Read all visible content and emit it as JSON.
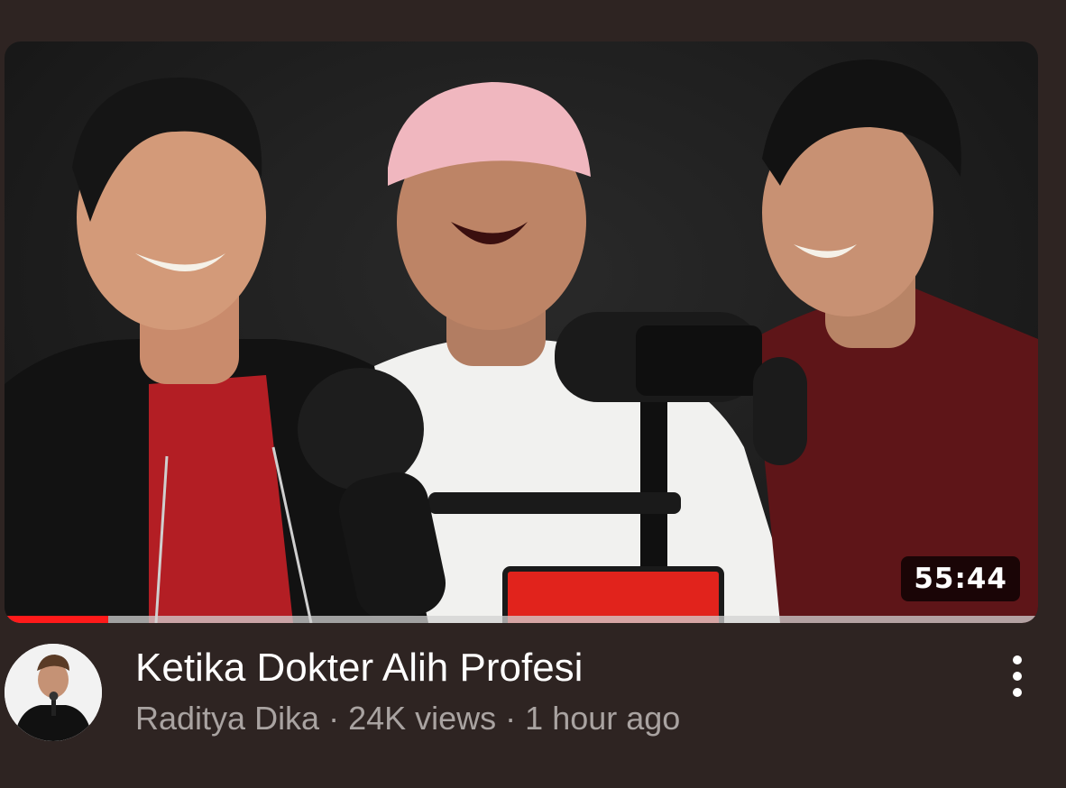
{
  "video": {
    "duration": "55:44",
    "progress_fraction": 0.1,
    "title": "Ketika Dokter Alih Profesi",
    "channel": "Raditya Dika",
    "views": "24K views",
    "age": "1 hour ago",
    "separator": "·"
  },
  "icons": {
    "menu": "more-vertical-icon",
    "avatar": "channel-avatar"
  },
  "colors": {
    "background": "#2e2422",
    "progress": "#ff1a1a",
    "title": "#ffffff",
    "secondary_text": "#a9a3a1"
  }
}
